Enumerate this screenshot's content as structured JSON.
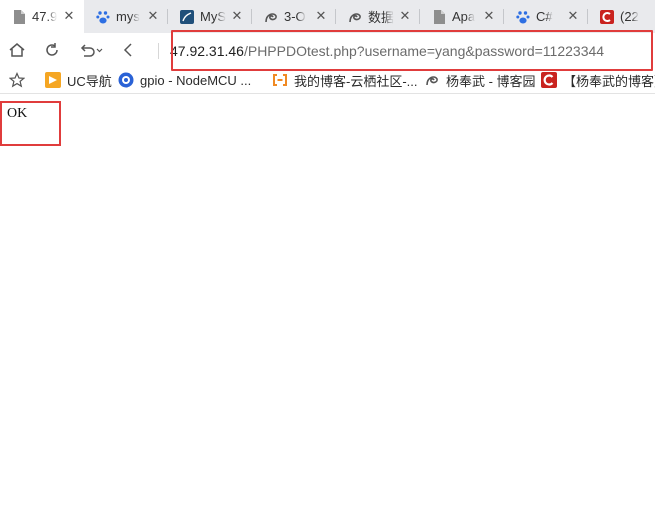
{
  "tabs": [
    {
      "label": "47.9",
      "icon": "document-icon",
      "active": true
    },
    {
      "label": "mys",
      "icon": "baidu-paw-icon"
    },
    {
      "label": "MyS",
      "icon": "mysql-icon"
    },
    {
      "label": "3-O",
      "icon": "swirl-logo-icon"
    },
    {
      "label": "数据",
      "icon": "swirl-logo-icon"
    },
    {
      "label": "Apa",
      "icon": "document-icon"
    },
    {
      "label": "C#",
      "icon": "baidu-paw-icon"
    },
    {
      "label": "(22",
      "icon": "csdn-c-icon"
    }
  ],
  "address": {
    "host": "47.92.31.46",
    "path": "/PHPPDOtest.php?username=yang&password=11223344"
  },
  "bookmarks": [
    {
      "label": "UC导航",
      "icon": "uc-nav-icon"
    },
    {
      "label": "gpio - NodeMCU ...",
      "icon": "nodemcu-icon"
    },
    {
      "label": "我的博客-云栖社区-...",
      "icon": "aliyun-icon"
    },
    {
      "label": "杨奉武 - 博客园",
      "icon": "swirl-logo-icon"
    },
    {
      "label": "【杨奉武的博客】",
      "icon": "csdn-c-icon"
    }
  ],
  "page": {
    "text": "OK"
  },
  "colors": {
    "highlight": "#e03c3c",
    "tabstrip": "#e9eaed"
  }
}
